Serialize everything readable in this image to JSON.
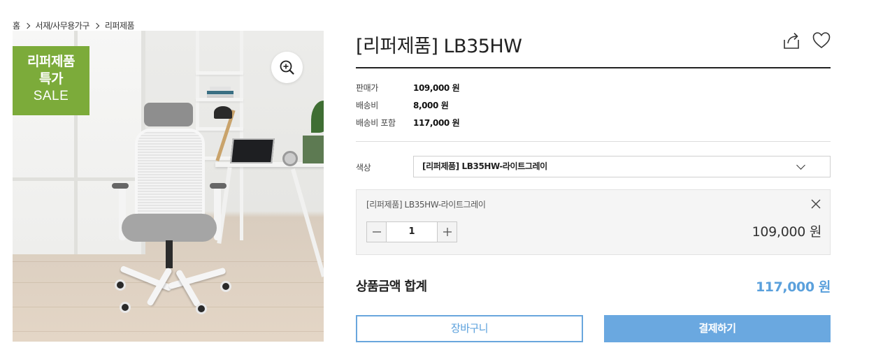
{
  "breadcrumb": {
    "home": "홈",
    "category": "서재/사무용가구",
    "subcategory": "리퍼제품"
  },
  "image": {
    "badge_line1": "리퍼제품",
    "badge_line2": "특가",
    "badge_line3": "SALE",
    "badge_color": "#7cab3a",
    "zoom_icon": "zoom-in-icon"
  },
  "product": {
    "title": "[리퍼제품] LB35HW"
  },
  "icons": {
    "share": "share-icon",
    "wishlist": "heart-icon"
  },
  "info": {
    "price_label": "판매가",
    "price_value": "109,000 원",
    "shipping_label": "배송비",
    "shipping_value": "8,000 원",
    "total_shipping_label": "배송비 포함",
    "total_shipping_value": "117,000 원"
  },
  "option": {
    "label": "색상",
    "selected": "[리퍼제품] LB35HW-라이트그레이"
  },
  "selected_item": {
    "name": "[리퍼제품] LB35HW-라이트그레이",
    "quantity": "1",
    "price": "109,000 원"
  },
  "total": {
    "label": "상품금액 합계",
    "value": "117,000 원"
  },
  "buttons": {
    "cart": "장바구니",
    "buy": "결제하기"
  },
  "colors": {
    "accent": "#5aa0dc",
    "buy_button": "#6aa8e0"
  }
}
